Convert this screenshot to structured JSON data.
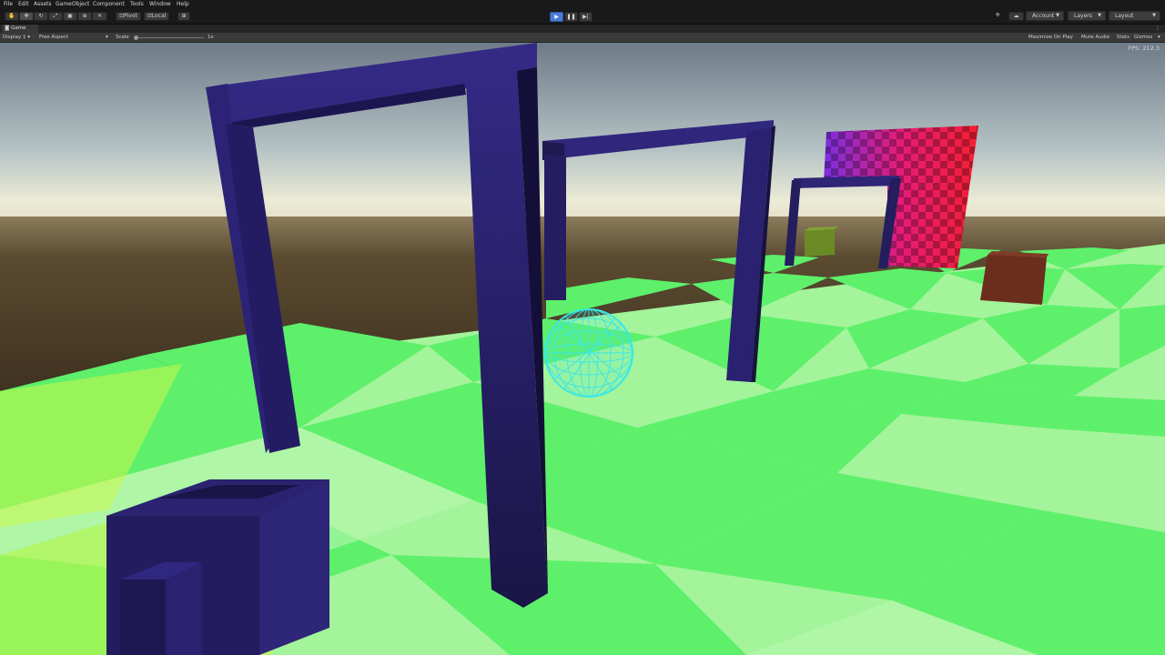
{
  "menu": [
    "File",
    "Edit",
    "Assets",
    "GameObject",
    "Component",
    "Tools",
    "Window",
    "Help"
  ],
  "toolbar": {
    "tools": [
      "hand-tool",
      "move-tool",
      "rotate-tool",
      "scale-tool",
      "rect-tool",
      "transform-tool",
      "custom-tool"
    ],
    "pivot_label": "Pivot",
    "local_label": "Local",
    "play_state": "playing",
    "account_label": "Account",
    "layers_label": "Layers",
    "layout_label": "Layout"
  },
  "tab": {
    "label": "Game"
  },
  "gamebar": {
    "display": "Display 1",
    "aspect": "Free Aspect",
    "scale_label": "Scale",
    "scale_value": "1x",
    "maximize_label": "Maximize On Play",
    "mute_label": "Mute Audio",
    "stats_label": "Stats",
    "gizmos_label": "Gizmos"
  },
  "fps": "FPS: 212.3",
  "colors": {
    "accent": "#4b7bd4",
    "arch": "#2c2470",
    "sphere": "#39e7e6",
    "floor_light": "#a4f59a",
    "floor_dark": "#5cf06a"
  }
}
